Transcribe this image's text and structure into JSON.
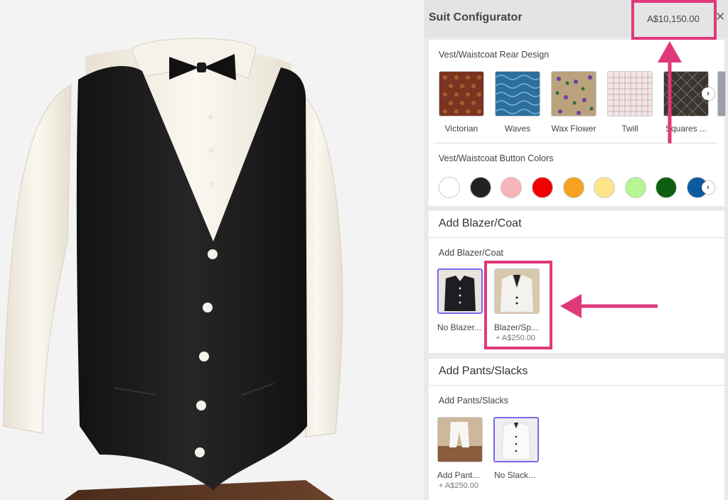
{
  "header": {
    "title": "Suit Configurator",
    "price": "A$10,150.00",
    "close_icon": "close-icon"
  },
  "vest_rear": {
    "title": "Vest/Waistcoat Rear Design",
    "items": [
      {
        "label": "Victorian",
        "color": "#7a3522"
      },
      {
        "label": "Waves",
        "color": "#2d6e9c"
      },
      {
        "label": "Wax Flower",
        "color": "#8d6d45"
      },
      {
        "label": "Twill",
        "color": "#ead8d8"
      },
      {
        "label": "Squares ...",
        "color": "#3a3531"
      }
    ]
  },
  "vest_buttons": {
    "title": "Vest/Waistcoat Button Colors",
    "colors": [
      "#ffffff",
      "#222222",
      "#f6b5b8",
      "#f00000",
      "#f5a320",
      "#fde68a",
      "#b6f591",
      "#0d5e10",
      "#0d5aa0"
    ]
  },
  "blazer": {
    "section_title": "Add Blazer/Coat",
    "sub_title": "Add Blazer/Coat",
    "options": [
      {
        "label": "No Blazer...",
        "price": ""
      },
      {
        "label": "Blazer/Sp...",
        "price": "+ A$250.00"
      }
    ]
  },
  "pants": {
    "section_title": "Add Pants/Slacks",
    "sub_title": "Add Pants/Slacks",
    "options": [
      {
        "label": "Add Pant...",
        "price": "+ A$250.00"
      },
      {
        "label": "No Slack...",
        "price": ""
      }
    ]
  },
  "highlight_color": "#e0397a",
  "selected_color": "#7b68ee"
}
